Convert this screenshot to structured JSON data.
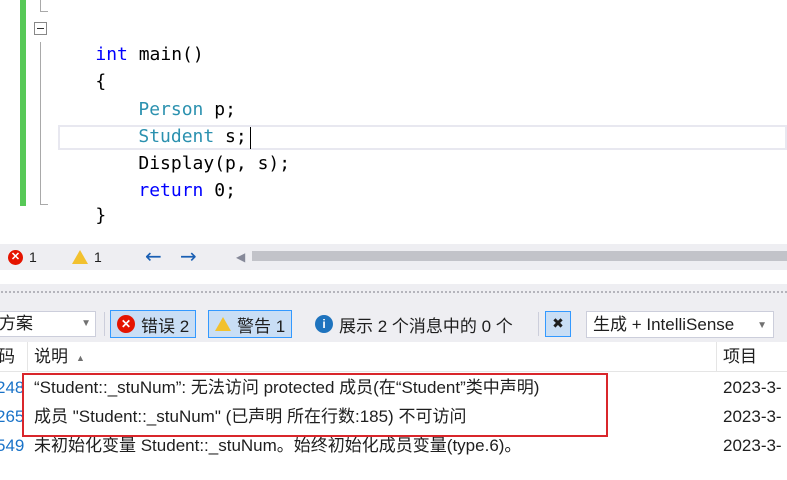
{
  "editor": {
    "lines": [
      {
        "kind": "func",
        "kw": "int",
        "rest": " main()"
      },
      {
        "kind": "plain",
        "text": "{"
      },
      {
        "kind": "decl",
        "type": "Person",
        "rest": " p;"
      },
      {
        "kind": "decl",
        "type": "Student",
        "rest": " s;"
      },
      {
        "kind": "plain",
        "text": "Display(p, s);"
      },
      {
        "kind": "ret",
        "kw": "return",
        "rest": " 0;"
      },
      {
        "kind": "plain",
        "text": "}"
      }
    ],
    "top_brace": "}"
  },
  "status_strip": {
    "error_count": "1",
    "warning_count": "1",
    "nav_back": "←",
    "nav_forward": "→"
  },
  "toolbar": {
    "scope_value": "方案",
    "errors_label": "错误 2",
    "warnings_label": "警告 1",
    "messages_label": "展示 2 个消息中的 0 个",
    "source_value": "生成 + IntelliSense"
  },
  "table": {
    "headers": {
      "code": "码",
      "description": "说明",
      "project": "项目"
    },
    "rows": [
      {
        "code": "248",
        "description": "“Student::_stuNum”: 无法访问 protected 成员(在“Student”类中声明)",
        "project": "2023-3-"
      },
      {
        "code": "265",
        "description": "成员 \"Student::_stuNum\" (已声明 所在行数:185) 不可访问",
        "project": "2023-3-"
      },
      {
        "code": "549",
        "description": "未初始化变量 Student::_stuNum。始终初始化成员变量(type.6)。",
        "project": "2023-3-"
      }
    ]
  },
  "colors": {
    "keyword": "#0000ff",
    "type": "#2b91af",
    "change_bar": "#57c957",
    "error": "#e51400",
    "warning": "#f2c12e",
    "info": "#1e73be",
    "highlight_box": "#d9262b"
  },
  "icons": {
    "error": "error-circle-icon",
    "warning": "warning-triangle-icon",
    "info": "info-circle-icon",
    "filter": "filter-icon"
  }
}
